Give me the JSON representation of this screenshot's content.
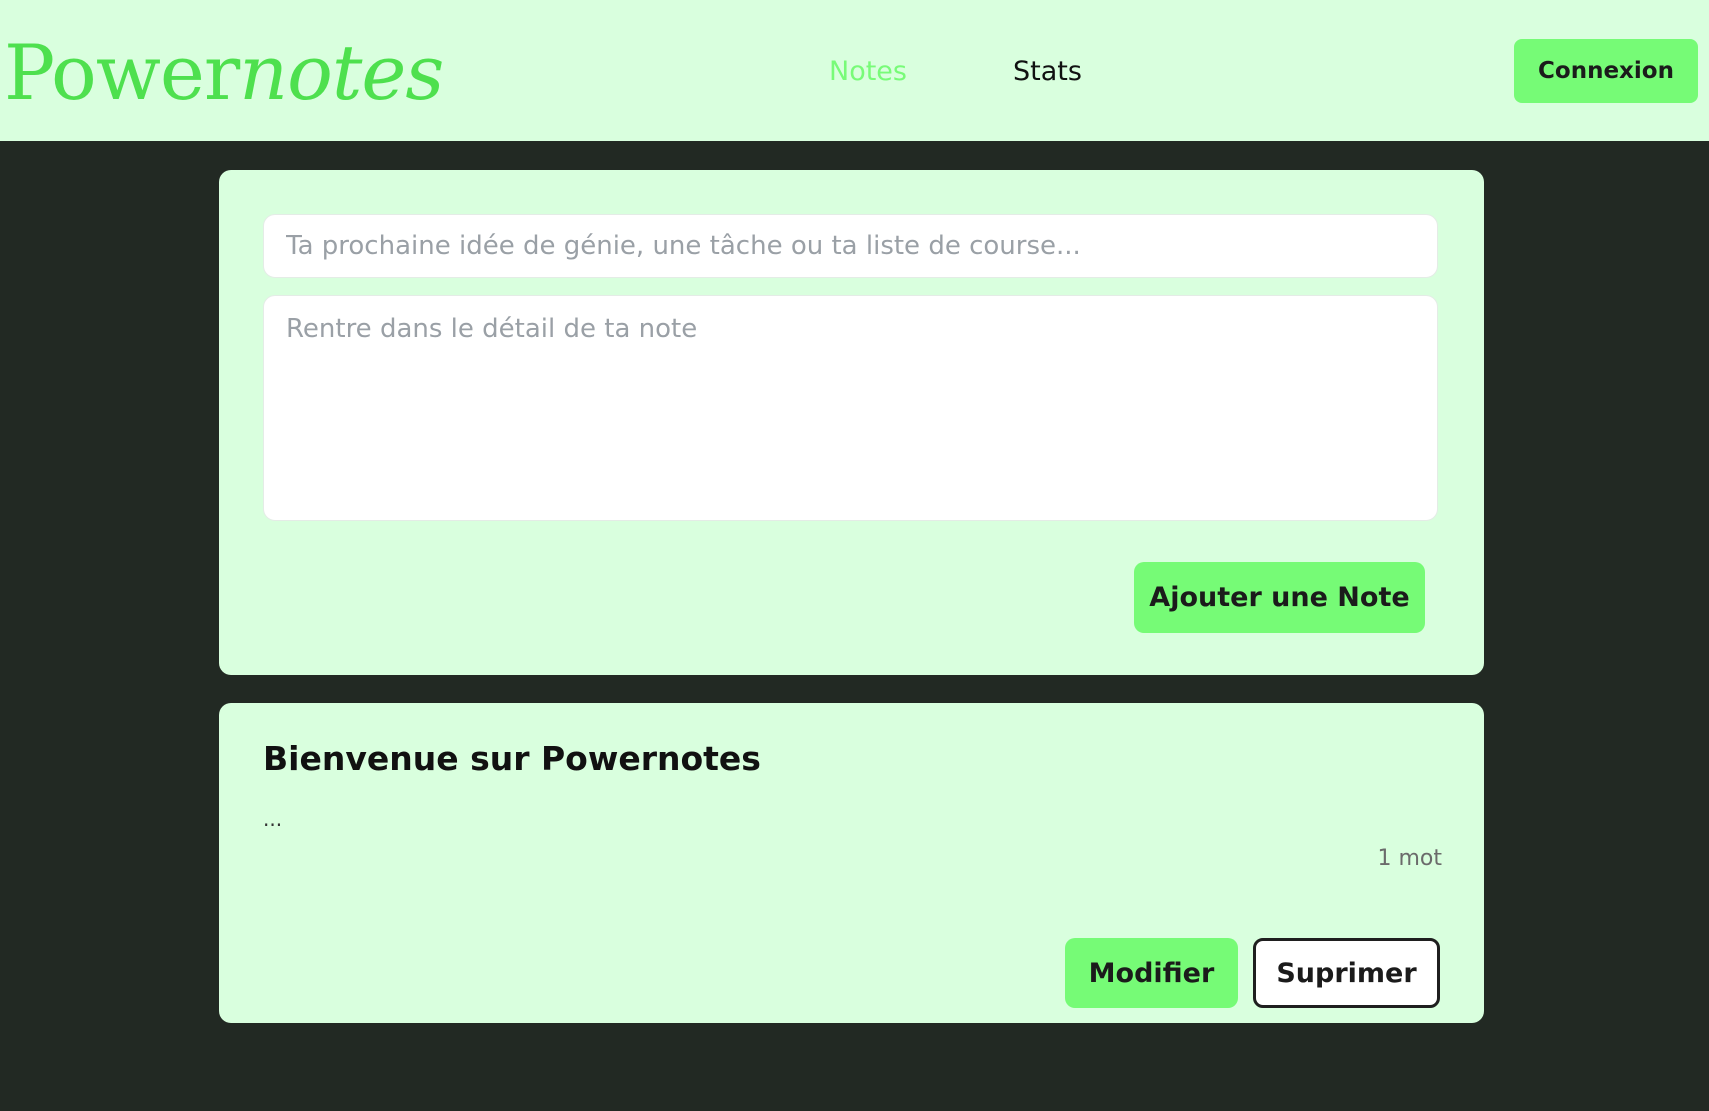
{
  "header": {
    "logo": {
      "regular": "Power",
      "italic": "notes"
    },
    "nav": {
      "notes_label": "Notes",
      "stats_label": "Stats"
    },
    "login_label": "Connexion"
  },
  "note_form": {
    "title_placeholder": "Ta prochaine idée de génie, une tâche ou ta liste de course...",
    "body_placeholder": "Rentre dans le détail de ta note",
    "add_label": "Ajouter une Note"
  },
  "notes": [
    {
      "title": "Bienvenue sur Powernotes",
      "body": "...",
      "word_count": "1 mot",
      "edit_label": "Modifier",
      "delete_label": "Suprimer"
    }
  ],
  "colors": {
    "page_background": "#222923",
    "surface": "#d9ffde",
    "accent": "#76fb76",
    "logo": "#4ee04e",
    "active_nav": "#78fb78"
  }
}
